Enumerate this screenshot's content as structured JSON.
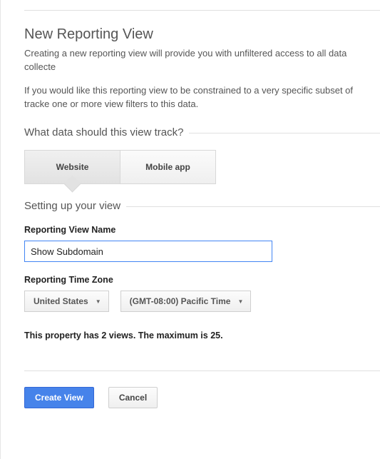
{
  "title": "New Reporting View",
  "description1": "Creating a new reporting view will provide you with unfiltered access to all data collecte",
  "description2": "If you would like this reporting view to be constrained to a very specific subset of tracke one or more view filters to this data.",
  "track_section_label": "What data should this view track?",
  "segmented": {
    "website_label": "Website",
    "mobile_app_label": "Mobile app",
    "active": "website"
  },
  "setup_section_label": "Setting up your view",
  "fields": {
    "view_name_label": "Reporting View Name",
    "view_name_value": "Show Subdomain",
    "timezone_label": "Reporting Time Zone",
    "country_value": "United States",
    "timezone_value": "(GMT-08:00) Pacific Time"
  },
  "views_note": "This property has 2 views. The maximum is 25.",
  "actions": {
    "create_label": "Create View",
    "cancel_label": "Cancel"
  }
}
